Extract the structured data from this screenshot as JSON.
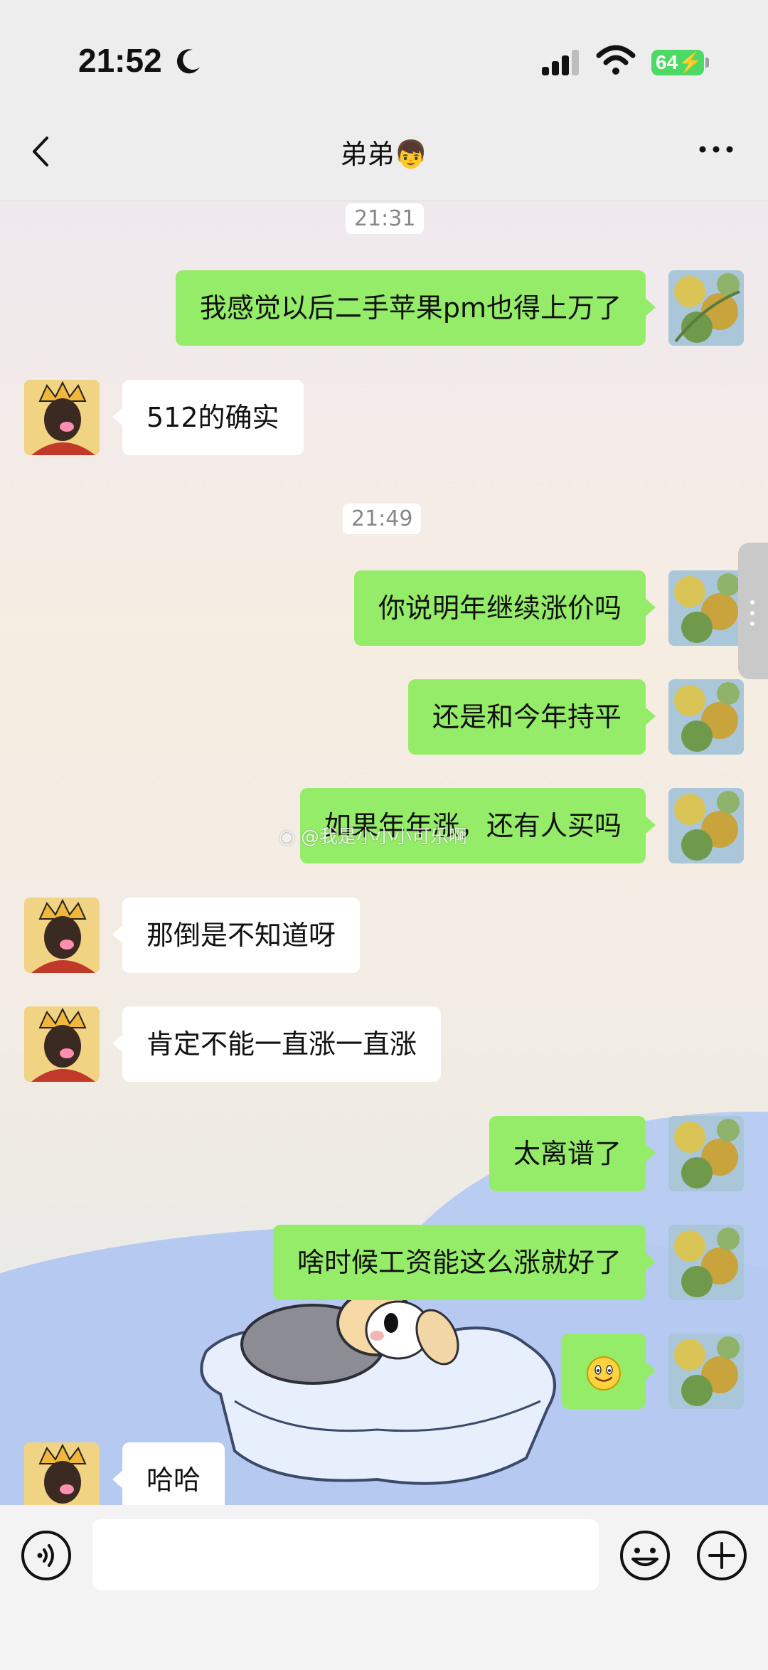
{
  "status_bar": {
    "time": "21:52",
    "battery_level": "64",
    "icons": [
      "moon-icon",
      "signal-icon",
      "wifi-icon",
      "battery-charging-icon"
    ]
  },
  "nav": {
    "title": "弟弟👦",
    "back_icon": "chevron-left-icon",
    "more_icon": "more-dots-icon"
  },
  "messages": {
    "ts1": "21:31",
    "m1": "我感觉以后二手苹果pm也得上万了",
    "m2": "512的确实",
    "ts2": "21:49",
    "m3": "你说明年继续涨价吗",
    "m4": "还是和今年持平",
    "m5": "如果年年涨，还有人买吗",
    "m6": "那倒是不知道呀",
    "m7": "肯定不能一直涨一直涨",
    "m8": "太离谱了",
    "m9": "啥时候工资能这么涨就好了",
    "m10_emoji": "smile-emoji",
    "m11": "哈哈"
  },
  "watermark": "@我是小小小可乐啊",
  "input": {
    "value": "",
    "icons": [
      "voice-icon",
      "emoji-icon",
      "plus-icon"
    ]
  },
  "colors": {
    "my_bubble": "#95ec69",
    "peer_bubble": "#ffffff",
    "nav_bg": "#ededed"
  }
}
